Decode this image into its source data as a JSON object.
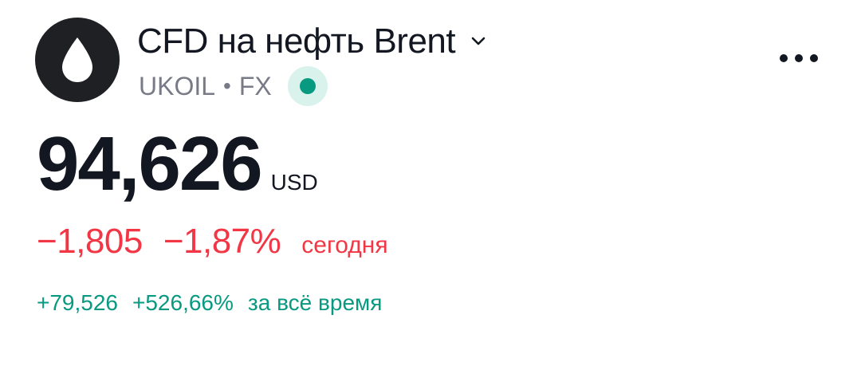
{
  "header": {
    "logo_icon": "oil-drop-icon",
    "title": "CFD на нефть Brent",
    "ticker": "UKOIL",
    "separator": "•",
    "exchange": "FX",
    "market_status_color": "#089981",
    "more_icon": "more-horizontal-icon"
  },
  "quote": {
    "price": "94,626",
    "currency": "USD",
    "change_abs": "−1,805",
    "change_pct": "−1,87%",
    "change_period": "сегодня",
    "negative_color": "#f23645",
    "alltime_abs": "+79,526",
    "alltime_pct": "+526,66%",
    "alltime_period": "за всё время",
    "positive_color": "#089981"
  }
}
